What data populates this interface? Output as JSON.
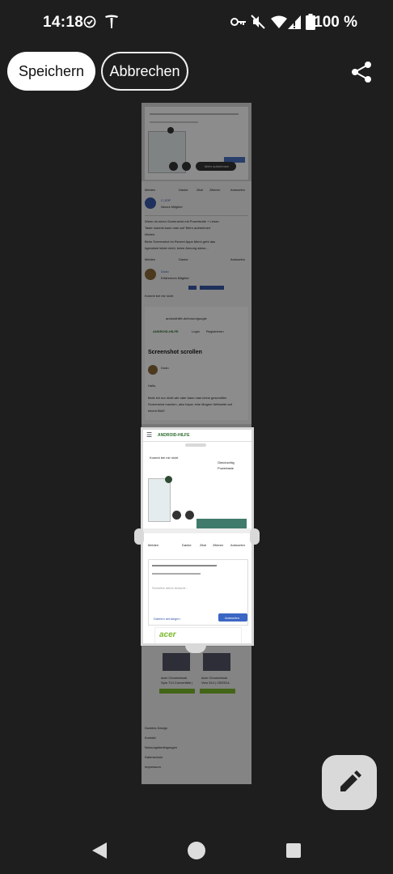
{
  "status_bar": {
    "time": "14:18",
    "battery": "100 %"
  },
  "toolbar": {
    "save_label": "Speichern",
    "cancel_label": "Abbrechen"
  },
  "preview_text": {
    "mehr_aufnehmen": "Mehr aufnehmen",
    "melden": "Melden",
    "danke": "Danke",
    "zitat": "Zitat",
    "zitieren": "Zitieren",
    "antworten": "Antworten",
    "user1": "C-3OP",
    "user1_role": "Neues Mitglied",
    "post1_line1": "Wenn du einen Screenshot mit Powerbutte + Leiser-",
    "post1_line2": "Taste machst kann man auf 'Mehr aufnehmen'",
    "post1_line3": "klicken.",
    "post1_line4": "Beim Screenshot im Recent Apps Menü geht das",
    "post1_line5": "irgendwie leider nicht, keine Ahnung wieso...",
    "user2": "Dodo",
    "user2_role": "Erfahrenes Mitglied",
    "post2": "Kommt bei mir nicht",
    "thread_title": "Screenshot scrollen",
    "site": "androidhilfe.de/forum/google",
    "login": "Login",
    "registrieren": "Registrieren",
    "hello": "Hallo,",
    "body1": "finde ich nur nicht wie oder kann man keine gescrollten",
    "body2": "Screenshot machen, also bspw. eine längere Webseite auf",
    "body3": "einem Bild?",
    "logo": "ANDROID-HILFE",
    "gleichzeitig": "Gleichzeitig",
    "powertaste": "Powertaste",
    "placeholder": "Schreibe deine Antwort...",
    "do_anhaenge": "Dateien anhängen",
    "antworten_btn": "Antworten",
    "ad_brand": "acer",
    "ad_prod1": "Acer Chromebook",
    "ad_prod1b": "Spin 714 Convertible |",
    "ad_prod2": "Acer Chromebook",
    "ad_prod2b": "Vero 514 | CBV514-",
    "ad_btn": "JETZT KAUFEN",
    "footer1": "Dunkles Design",
    "footer2": "Kontakt",
    "footer3": "Nutzungsbedingungen",
    "footer4": "Datenschutz",
    "footer5": "Impressum"
  }
}
